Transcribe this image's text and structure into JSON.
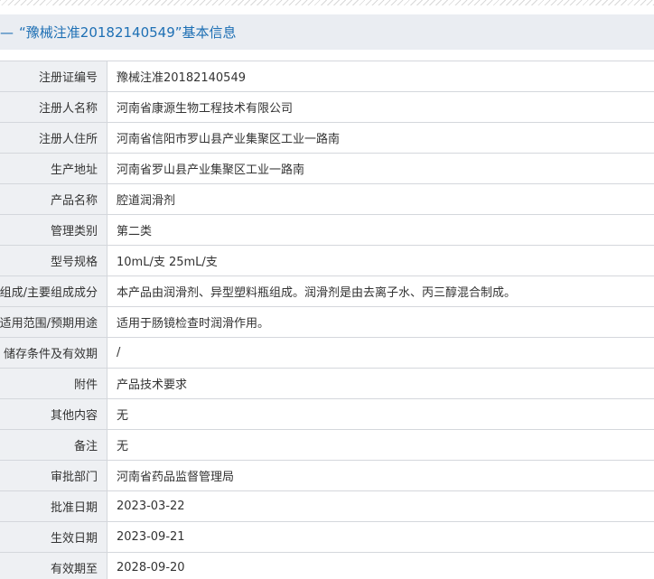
{
  "section": {
    "dash": "—",
    "title": "“豫械注准20182140549”基本信息"
  },
  "colors": {
    "accent": "#1d6fb4",
    "header_bg": "#eaedf2",
    "label_bg": "#eef0f3",
    "border": "#d4d7dc",
    "text": "#333333"
  },
  "rows": [
    {
      "label": "注册证编号",
      "value": "豫械注准20182140549"
    },
    {
      "label": "注册人名称",
      "value": "河南省康源生物工程技术有限公司"
    },
    {
      "label": "注册人住所",
      "value": "河南省信阳市罗山县产业集聚区工业一路南"
    },
    {
      "label": "生产地址",
      "value": "河南省罗山县产业集聚区工业一路南"
    },
    {
      "label": "产品名称",
      "value": "腔道润滑剂"
    },
    {
      "label": "管理类别",
      "value": "第二类"
    },
    {
      "label": "型号规格",
      "value": "10mL/支 25mL/支"
    },
    {
      "label": "组成/主要组成成分",
      "value": "本产品由润滑剂、异型塑料瓶组成。润滑剂是由去离子水、丙三醇混合制成。"
    },
    {
      "label": "适用范围/预期用途",
      "value": "适用于肠镜检查时润滑作用。"
    },
    {
      "label": "储存条件及有效期",
      "value": "/"
    },
    {
      "label": "附件",
      "value": "产品技术要求"
    },
    {
      "label": "其他内容",
      "value": "无"
    },
    {
      "label": "备注",
      "value": "无"
    },
    {
      "label": "审批部门",
      "value": "河南省药品监督管理局"
    },
    {
      "label": "批准日期",
      "value": "2023-03-22"
    },
    {
      "label": "生效日期",
      "value": "2023-09-21"
    },
    {
      "label": "有效期至",
      "value": "2028-09-20"
    }
  ]
}
